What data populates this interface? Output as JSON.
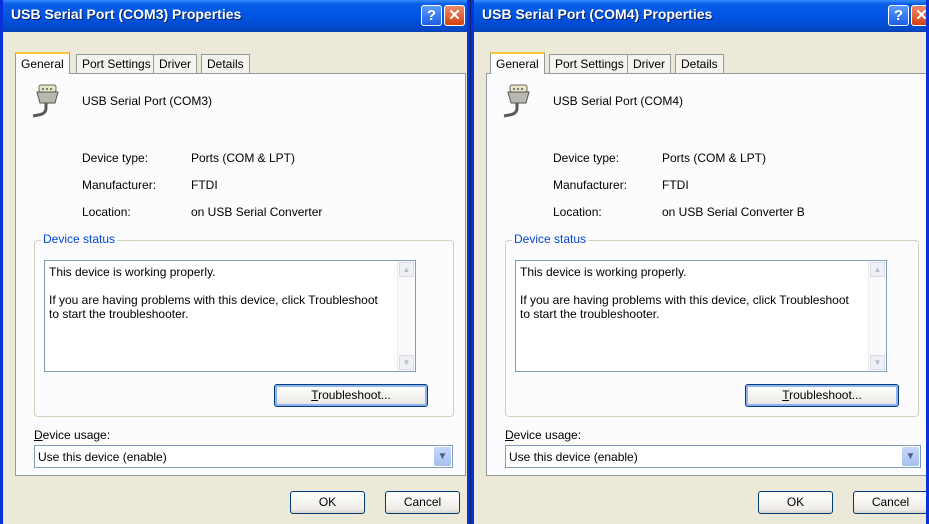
{
  "windows": [
    {
      "title": "USB Serial Port (COM3) Properties",
      "title_buttons": {
        "help": "?",
        "close": "✕"
      },
      "tabs": [
        "General",
        "Port Settings",
        "Driver",
        "Details"
      ],
      "active_tab": "General",
      "device_name": "USB Serial Port (COM3)",
      "properties": [
        {
          "label": "Device type:",
          "value": "Ports (COM & LPT)"
        },
        {
          "label": "Manufacturer:",
          "value": "FTDI"
        },
        {
          "label": "Location:",
          "value": "on USB Serial Converter"
        }
      ],
      "status_group_title": "Device status",
      "status_lines": [
        "This device is working properly.",
        "If you are having problems with this device, click Troubleshoot to start the troubleshooter."
      ],
      "troubleshoot": {
        "mnemonic": "T",
        "rest": "roubleshoot..."
      },
      "usage_label": {
        "mnemonic": "D",
        "rest": "evice usage:"
      },
      "usage_value": "Use this device (enable)",
      "ok": "OK",
      "cancel": "Cancel",
      "icon": "serial-port-icon"
    },
    {
      "title": "USB Serial Port (COM4) Properties",
      "title_buttons": {
        "help": "?",
        "close": "✕"
      },
      "tabs": [
        "General",
        "Port Settings",
        "Driver",
        "Details"
      ],
      "active_tab": "General",
      "device_name": "USB Serial Port (COM4)",
      "properties": [
        {
          "label": "Device type:",
          "value": "Ports (COM & LPT)"
        },
        {
          "label": "Manufacturer:",
          "value": "FTDI"
        },
        {
          "label": "Location:",
          "value": "on USB Serial Converter B"
        }
      ],
      "status_group_title": "Device status",
      "status_lines": [
        "This device is working properly.",
        "If you are having problems with this device, click Troubleshoot to start the troubleshooter."
      ],
      "troubleshoot": {
        "mnemonic": "T",
        "rest": "roubleshoot..."
      },
      "usage_label": {
        "mnemonic": "D",
        "rest": "evice usage:"
      },
      "usage_value": "Use this device (enable)",
      "ok": "OK",
      "cancel": "Cancel",
      "icon": "serial-port-icon"
    }
  ],
  "colors": {
    "titlebar": "#0054e3",
    "dialog_bg": "#ece9d8",
    "active_tab_accent": "#ffc73c",
    "group_title": "#0046d5"
  }
}
